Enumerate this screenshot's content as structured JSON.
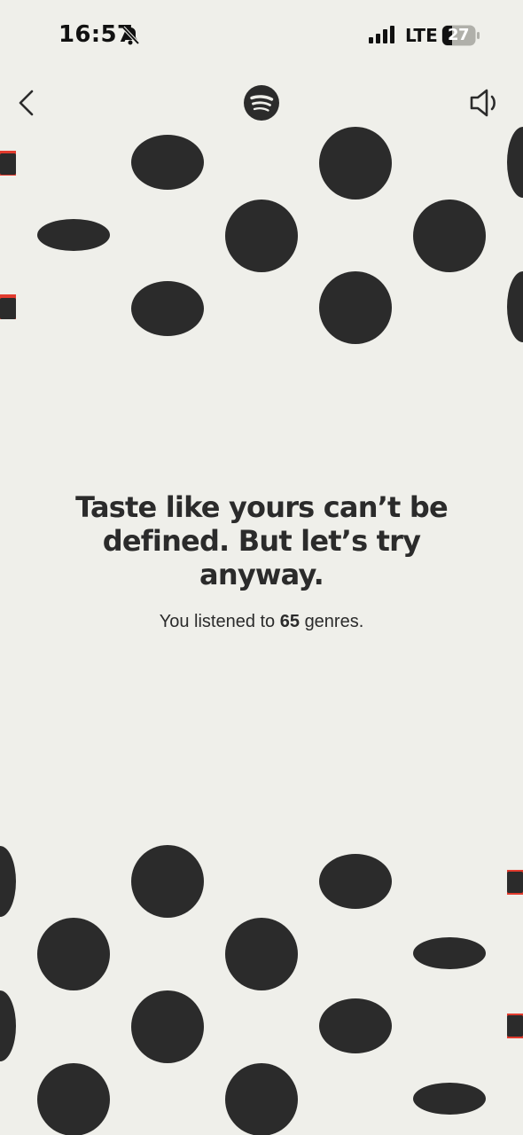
{
  "status_bar": {
    "time": "16:57",
    "network": "LTE",
    "battery_level": "27",
    "icons": [
      "bell-slash-icon",
      "signal-bars-icon",
      "battery-icon"
    ]
  },
  "nav": {
    "back_icon": "chevron-left-icon",
    "logo": "spotify-logo",
    "sound_icon": "speaker-icon"
  },
  "content": {
    "headline_line1": "Taste like yours can’t be",
    "headline_line2": "defined. But let’s try",
    "headline_line3": "anyway.",
    "subtitle_prefix": "You listened to",
    "genre_count": "65",
    "subtitle_suffix": "genres."
  },
  "colors": {
    "background": "#efefea",
    "ink": "#2b2b2b",
    "accent_red": "#e23b2e"
  }
}
